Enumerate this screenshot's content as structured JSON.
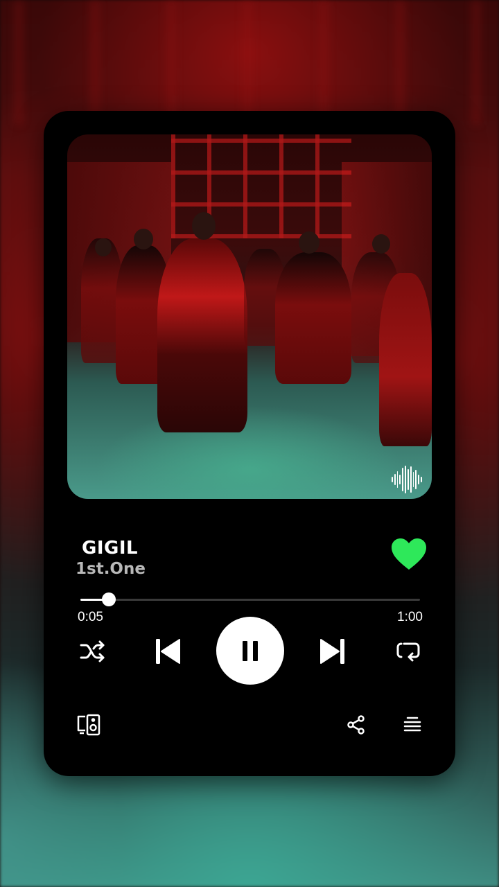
{
  "player": {
    "song_title": "GIGIL",
    "artist": "1st.One",
    "liked": true,
    "elapsed_time": "0:05",
    "total_time": "1:00",
    "progress_fraction": 0.0833,
    "state": "playing"
  },
  "icons": {
    "waveform": "waveform-icon",
    "heart": "heart-icon",
    "shuffle": "shuffle-icon",
    "previous": "skip-previous-icon",
    "pause": "pause-icon",
    "next": "skip-next-icon",
    "repeat": "repeat-icon",
    "devices": "connect-device-icon",
    "share": "share-icon",
    "queue": "queue-icon"
  },
  "colors": {
    "accent_heart": "#2ee85a",
    "card_background": "#000000",
    "text_primary": "#ffffff",
    "text_secondary": "#b8b8b8"
  }
}
